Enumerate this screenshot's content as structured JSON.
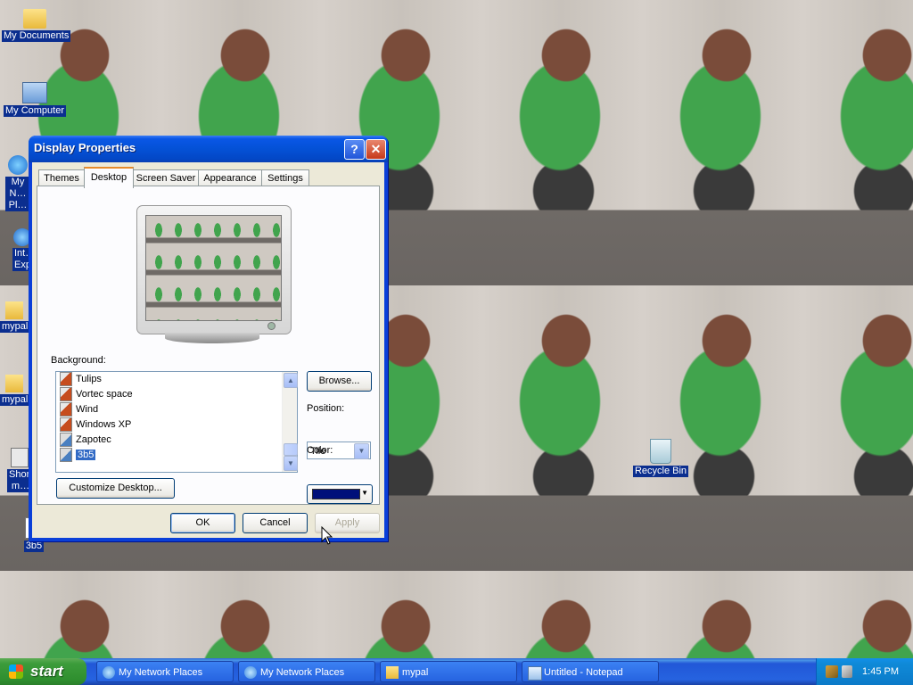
{
  "desktop": {
    "icons": [
      {
        "label": "My Documents"
      },
      {
        "label": "My Computer"
      },
      {
        "label": "My N… Pl…"
      },
      {
        "label": "Int… Exp…"
      },
      {
        "label": "mypal…"
      },
      {
        "label": "mypal…"
      },
      {
        "label": "Shor… m…"
      },
      {
        "label": "3b5"
      },
      {
        "label": "Recycle Bin"
      }
    ]
  },
  "window": {
    "title": "Display Properties",
    "help": "?",
    "close": "✕",
    "tabs": [
      {
        "label": "Themes"
      },
      {
        "label": "Desktop"
      },
      {
        "label": "Screen Saver"
      },
      {
        "label": "Appearance"
      },
      {
        "label": "Settings"
      }
    ],
    "active_tab": "Desktop",
    "background_label": "Background:",
    "background_items": [
      {
        "label": "Tulips"
      },
      {
        "label": "Vortec space"
      },
      {
        "label": "Wind"
      },
      {
        "label": "Windows XP"
      },
      {
        "label": "Zapotec"
      },
      {
        "label": "3b5"
      }
    ],
    "selected_background": "3b5",
    "browse_label": "Browse...",
    "position_label": "Position:",
    "position_value": "Tile",
    "color_label": "Color:",
    "color_value": "#00107a",
    "customize_label": "Customize Desktop...",
    "ok_label": "OK",
    "cancel_label": "Cancel",
    "apply_label": "Apply"
  },
  "taskbar": {
    "start_label": "start",
    "tasks": [
      {
        "label": "My Network Places"
      },
      {
        "label": "My Network Places"
      },
      {
        "label": "mypal"
      },
      {
        "label": "Untitled - Notepad"
      }
    ],
    "clock": "1:45 PM"
  },
  "colors": {
    "titlebar": "#0451d6",
    "taskbar": "#2663e0",
    "start_button": "#3c9c3b",
    "dialog_face": "#ece9d8",
    "selection": "#316ac5"
  }
}
